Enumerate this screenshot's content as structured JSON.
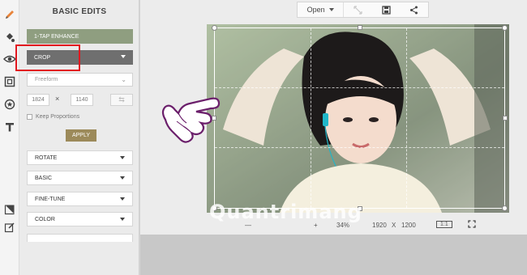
{
  "panel": {
    "title": "BASIC EDITS",
    "enhance_label": "1-TAP ENHANCE",
    "crop_label": "CROP",
    "crop_preset": "Freeform",
    "width_value": "1824",
    "height_value": "1140",
    "times_symbol": "×",
    "keep_proportions_label": "Keep Proportions",
    "apply_label": "APPLY",
    "sections": [
      {
        "label": "ROTATE"
      },
      {
        "label": "BASIC"
      },
      {
        "label": "FINE-TUNE"
      },
      {
        "label": "COLOR"
      },
      {
        "label": ""
      }
    ]
  },
  "topbar": {
    "open_label": "Open",
    "icons": [
      "resize-icon",
      "save-icon",
      "share-icon"
    ]
  },
  "footer": {
    "zoom_percent": "34%",
    "image_width": "1920",
    "times": "X",
    "image_height": "1200",
    "ratio_label": "1:1",
    "fullscreen_icon": "fullscreen-icon"
  },
  "watermark": {
    "text": "Quantrimang"
  },
  "rail_icons": [
    "pencil-icon",
    "paint-bucket-icon",
    "eye-icon",
    "frame-icon",
    "sticker-icon",
    "text-icon",
    "layers-icon",
    "edit-icon"
  ],
  "colors": {
    "enhance_bg": "#8f9e80",
    "crop_bg": "#6f6f6f",
    "apply_bg": "#9c8a5a",
    "highlight": "#e2171f",
    "accent_orange": "#e8843a"
  }
}
